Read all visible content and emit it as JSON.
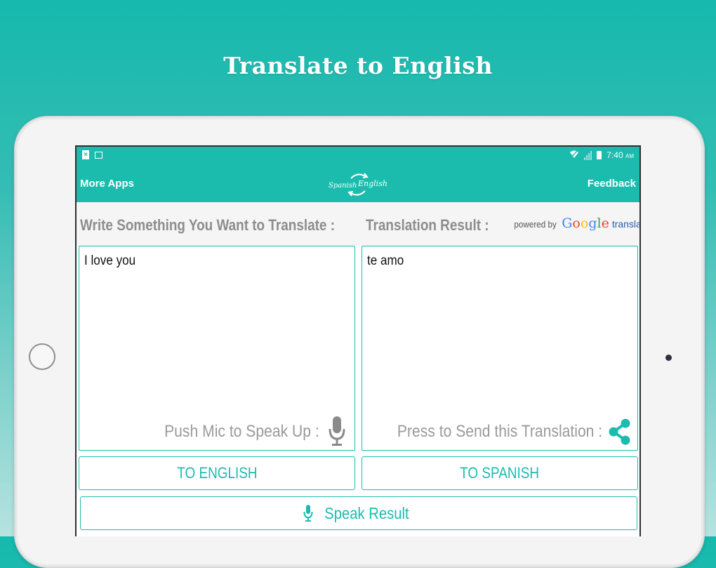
{
  "headline": "Translate to English",
  "status_bar": {
    "time": "7:40",
    "ampm": "AM"
  },
  "app_bar": {
    "left_action": "More Apps",
    "logo_word_1": "Spanish",
    "logo_word_2": "English",
    "right_action": "Feedback"
  },
  "labels": {
    "input_label": "Write Something You Want to Translate :",
    "result_label": "Translation Result :",
    "powered_by": "powered by",
    "powered_brand": "Google",
    "powered_suffix": "translate"
  },
  "input_box": {
    "text": "I love you",
    "hint": "Push Mic to Speak Up :"
  },
  "result_box": {
    "text": "te amo",
    "hint": "Press to Send this Translation :"
  },
  "buttons": {
    "to_english": "TO ENGLISH",
    "to_spanish": "TO SPANISH",
    "speak_result": "Speak Result"
  },
  "colors": {
    "accent": "#1bbcae",
    "label_gray": "#8d8d8d",
    "hint_gray": "#9a9a9a"
  },
  "icons": [
    "mic-icon",
    "share-icon",
    "sim-icon",
    "image-icon",
    "signal-icon",
    "battery-icon"
  ]
}
